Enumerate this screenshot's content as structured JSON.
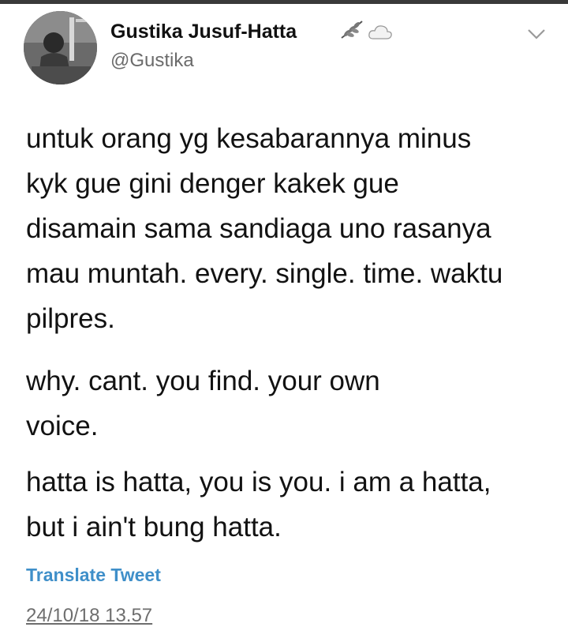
{
  "author": {
    "display_name": "Gustika Jusuf-Hatta",
    "handle": "@Gustika",
    "badges": [
      "leaf-icon",
      "cloud-icon"
    ]
  },
  "tweet": {
    "paragraphs": [
      [
        "untuk orang yg kesabarannya minus",
        "kyk gue gini denger kakek gue",
        "disamain sama sandiaga uno rasanya",
        "mau muntah. every. single. time. waktu",
        "pilpres."
      ],
      [
        "why. cant. you find. your own",
        "voice."
      ],
      [
        "hatta is hatta, you is you. i am a hatta,",
        "but i ain't bung hatta."
      ]
    ],
    "translate_label": "Translate Tweet",
    "timestamp": "24/10/18 13.57"
  },
  "colors": {
    "link": "#3f8fc9",
    "secondary_text": "#6b6b6b",
    "body_text": "#121212"
  }
}
